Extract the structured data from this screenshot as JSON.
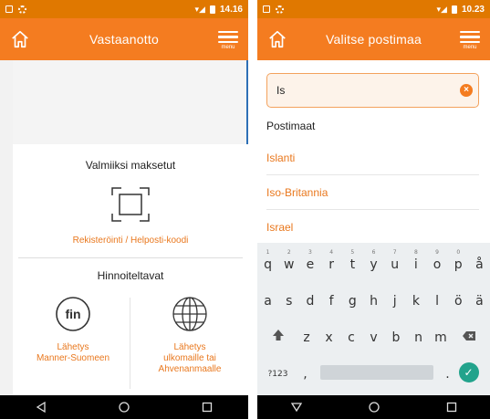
{
  "phone1": {
    "status": {
      "signal": "▾◢",
      "time": "14.16"
    },
    "appbar": {
      "title": "Vastaanotto",
      "menu_label": "menu"
    },
    "prepaid": {
      "title": "Valmiiksi maksetut",
      "link": "Rekisteröinti / Helposti-koodi"
    },
    "priced": {
      "title": "Hinnoiteltavat",
      "domestic": {
        "badge": "fin",
        "line1": "Lähetys",
        "line2": "Manner-Suomeen"
      },
      "abroad": {
        "line1": "Lähetys",
        "line2": "ulkomaille tai",
        "line3": "Ahvenanmaalle"
      }
    }
  },
  "phone2": {
    "status": {
      "signal": "▾◢",
      "time": "10.23"
    },
    "appbar": {
      "title": "Valitse postimaa",
      "menu_label": "menu"
    },
    "search": {
      "value": "Is"
    },
    "list_header": "Postimaat",
    "countries": [
      "Islanti",
      "Iso-Britannia",
      "Israel"
    ],
    "keyboard": {
      "row1": [
        {
          "k": "q",
          "n": "1"
        },
        {
          "k": "w",
          "n": "2"
        },
        {
          "k": "e",
          "n": "3"
        },
        {
          "k": "r",
          "n": "4"
        },
        {
          "k": "t",
          "n": "5"
        },
        {
          "k": "y",
          "n": "6"
        },
        {
          "k": "u",
          "n": "7"
        },
        {
          "k": "i",
          "n": "8"
        },
        {
          "k": "o",
          "n": "9"
        },
        {
          "k": "p",
          "n": "0"
        },
        {
          "k": "å",
          "n": ""
        }
      ],
      "row2": [
        "a",
        "s",
        "d",
        "f",
        "g",
        "h",
        "j",
        "k",
        "l",
        "ö",
        "ä"
      ],
      "row3": [
        "z",
        "x",
        "c",
        "v",
        "b",
        "n",
        "m"
      ],
      "sym_label": "?123",
      "comma": ",",
      "period": "."
    }
  },
  "colors": {
    "status": "#e07800",
    "appbar": "#f47c20",
    "accent": "#e9781e",
    "enter": "#22a38c"
  },
  "icons": [
    "home-icon",
    "hamburger-menu-icon",
    "scan-frame-icon",
    "fin-badge-icon",
    "globe-icon",
    "back-nav-icon",
    "home-nav-icon",
    "recents-nav-icon",
    "clear-icon",
    "shift-icon",
    "backspace-icon",
    "enter-check-icon"
  ]
}
